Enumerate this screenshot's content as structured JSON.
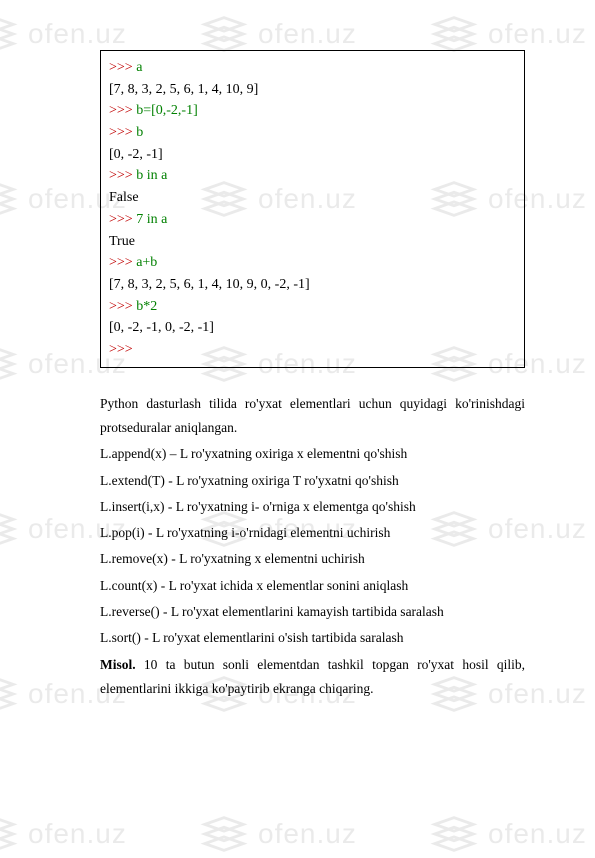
{
  "watermark": {
    "text": "ofen.uz"
  },
  "code": {
    "l1_prompt": ">>>",
    "l1_cmd": " a",
    "l2_out": "[7, 8, 3, 2, 5, 6, 1, 4, 10, 9]",
    "l3_prompt": ">>>",
    "l3_cmd": " b=[0,-2,-1]",
    "l4_prompt": ">>>",
    "l4_cmd": " b",
    "l5_out": "[0, -2, -1]",
    "l6_prompt": ">>>",
    "l6_cmd": " b in a",
    "l7_out": "False",
    "l8_prompt": ">>>",
    "l8_cmd": " 7 in a",
    "l9_out": "True",
    "l10_prompt": ">>>",
    "l10_cmd": " a+b",
    "l11_out": "[7, 8, 3, 2, 5, 6, 1, 4, 10, 9, 0, -2, -1]",
    "l12_prompt": ">>>",
    "l12_cmd": " b*2",
    "l13_out": "[0, -2, -1, 0, -2, -1]",
    "l14_prompt": ">>>"
  },
  "para": {
    "p1": "Python dasturlash tilida ro'yxat elementlari uchun quyidagi ko'rinishdagi protseduralar aniqlangan.",
    "p2": "L.append(x) – L ro'yxatning oxiriga x elementni qo'shish",
    "p3": "L.extend(T) - L ro'yxatning oxiriga T ro'yxatni qo'shish",
    "p4": "L.insert(i,x) - L ro'yxatning i- o'rniga x elementga qo'shish",
    "p5": "L.pop(i) - L ro'yxatning i-o'rnidagi elementni uchirish",
    "p6": "L.remove(x) - L ro'yxatning x elementni uchirish",
    "p7": "L.count(x) - L ro'yxat ichida x elementlar sonini aniqlash",
    "p8": "L.reverse() - L ro'yxat elementlarini kamayish tartibida saralash",
    "p9": "L.sort() - L ro'yxat elementlarini o'sish tartibida saralash",
    "p10_bold": "Misol.",
    "p10_rest": " 10 ta butun sonli elementdan tashkil topgan ro'yxat hosil qilib, elementlarini ikkiga ko'paytirib ekranga chiqaring."
  }
}
